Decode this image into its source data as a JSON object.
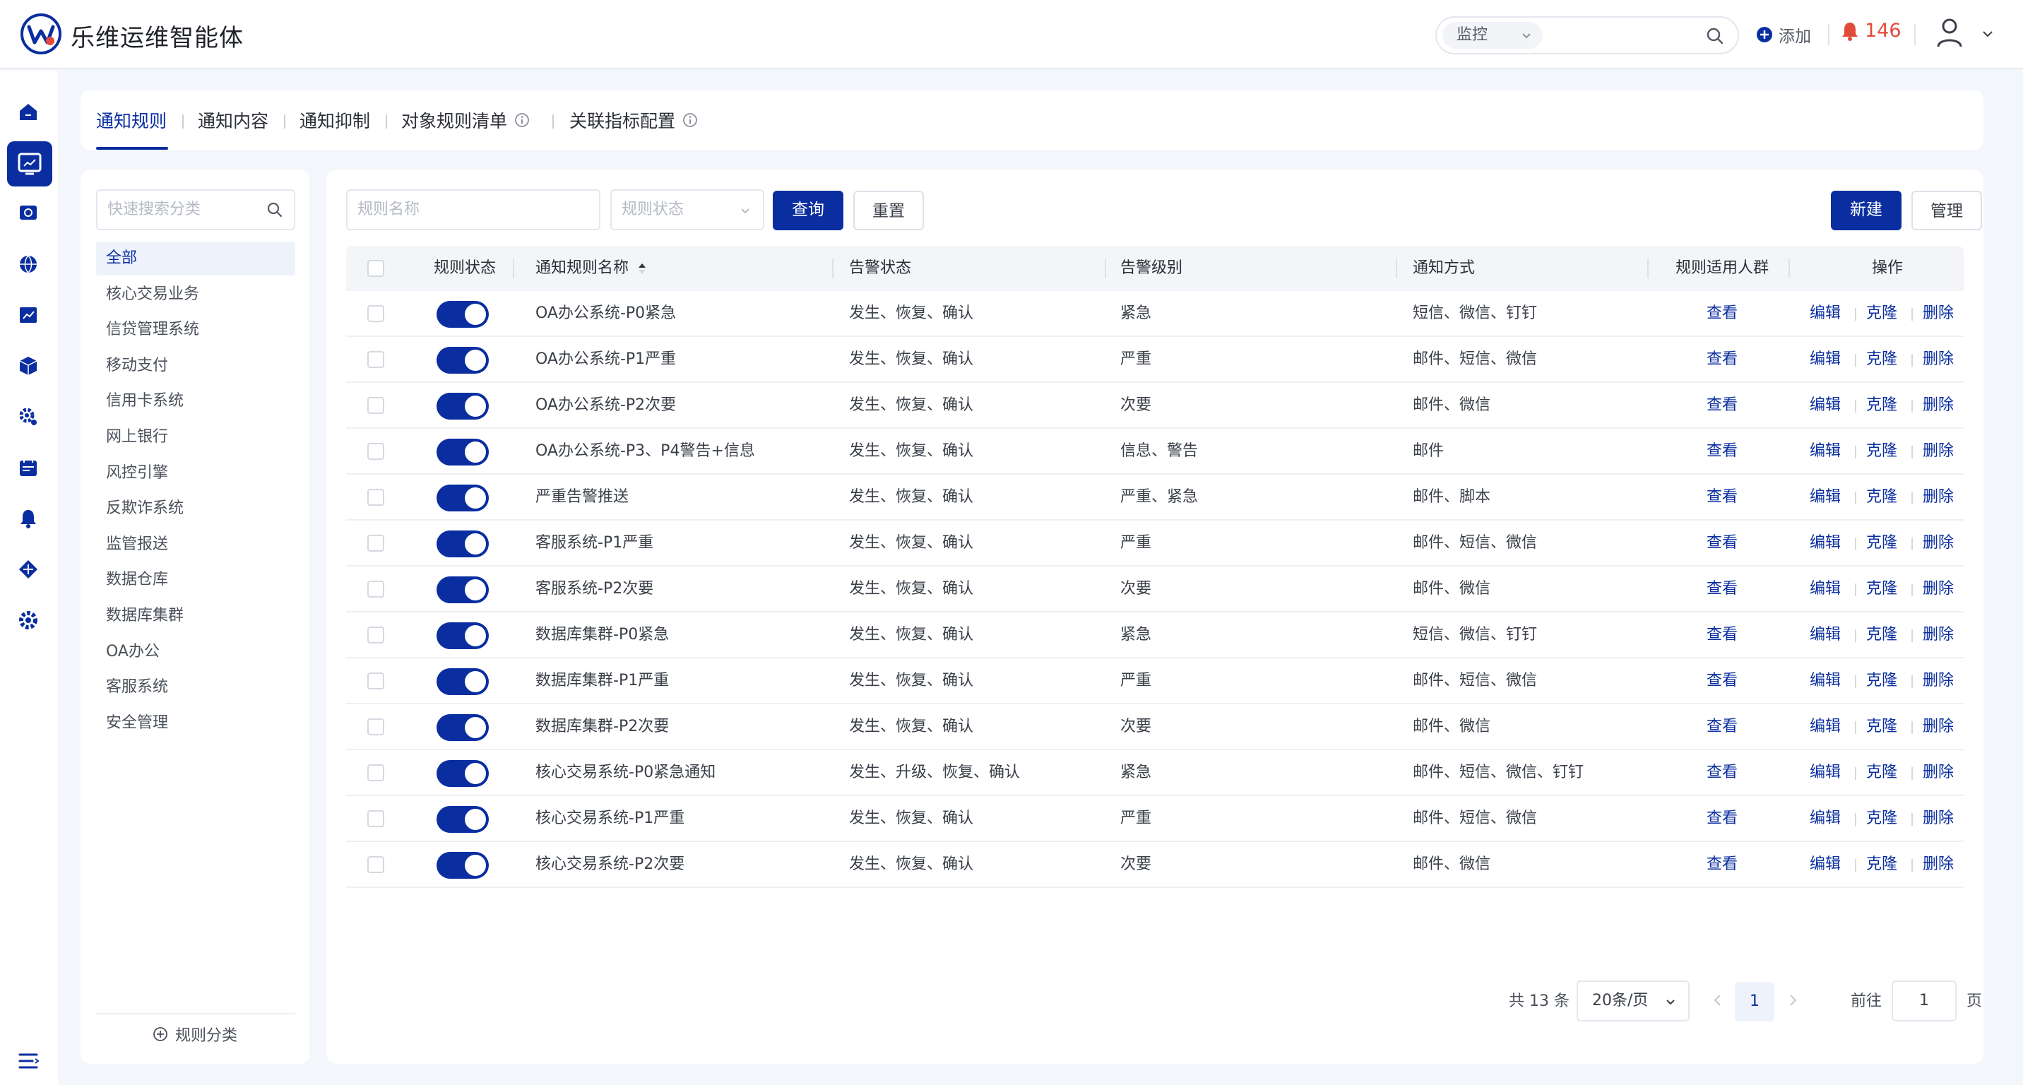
{
  "app": {
    "title": "乐维运维智能体"
  },
  "header": {
    "search_scope": "监控",
    "search_placeholder": "",
    "add_label": "添加",
    "alarm_count": "146"
  },
  "tabs": [
    {
      "label": "通知规则",
      "active": true
    },
    {
      "label": "通知内容"
    },
    {
      "label": "通知抑制"
    },
    {
      "label": "对象规则清单",
      "info": true
    },
    {
      "label": "关联指标配置",
      "info": true
    }
  ],
  "categories": {
    "search_placeholder": "快速搜索分类",
    "items": [
      "全部",
      "核心交易业务",
      "信贷管理系统",
      "移动支付",
      "信用卡系统",
      "网上银行",
      "风控引擎",
      "反欺诈系统",
      "监管报送",
      "数据仓库",
      "数据库集群",
      "OA办公",
      "客服系统",
      "安全管理"
    ],
    "active_index": 0,
    "add_label": "规则分类"
  },
  "filters": {
    "name_placeholder": "规则名称",
    "status_placeholder": "规则状态",
    "query_label": "查询",
    "reset_label": "重置",
    "new_label": "新建",
    "manage_label": "管理"
  },
  "table": {
    "headers": {
      "status": "规则状态",
      "name": "通知规则名称",
      "alarm_state": "告警状态",
      "alarm_level": "告警级别",
      "method": "通知方式",
      "audience": "规则适用人群",
      "ops": "操作"
    },
    "view_label": "查看",
    "edit_label": "编辑",
    "clone_label": "克隆",
    "delete_label": "删除",
    "rows": [
      {
        "name": "OA办公系统-P0紧急",
        "state": "发生、恢复、确认",
        "level": "紧急",
        "method": "短信、微信、钉钉"
      },
      {
        "name": "OA办公系统-P1严重",
        "state": "发生、恢复、确认",
        "level": "严重",
        "method": "邮件、短信、微信"
      },
      {
        "name": "OA办公系统-P2次要",
        "state": "发生、恢复、确认",
        "level": "次要",
        "method": "邮件、微信"
      },
      {
        "name": "OA办公系统-P3、P4警告+信息",
        "state": "发生、恢复、确认",
        "level": "信息、警告",
        "method": "邮件"
      },
      {
        "name": "严重告警推送",
        "state": "发生、恢复、确认",
        "level": "严重、紧急",
        "method": "邮件、脚本"
      },
      {
        "name": "客服系统-P1严重",
        "state": "发生、恢复、确认",
        "level": "严重",
        "method": "邮件、短信、微信"
      },
      {
        "name": "客服系统-P2次要",
        "state": "发生、恢复、确认",
        "level": "次要",
        "method": "邮件、微信"
      },
      {
        "name": "数据库集群-P0紧急",
        "state": "发生、恢复、确认",
        "level": "紧急",
        "method": "短信、微信、钉钉"
      },
      {
        "name": "数据库集群-P1严重",
        "state": "发生、恢复、确认",
        "level": "严重",
        "method": "邮件、短信、微信"
      },
      {
        "name": "数据库集群-P2次要",
        "state": "发生、恢复、确认",
        "level": "次要",
        "method": "邮件、微信"
      },
      {
        "name": "核心交易系统-P0紧急通知",
        "state": "发生、升级、恢复、确认",
        "level": "紧急",
        "method": "邮件、短信、微信、钉钉"
      },
      {
        "name": "核心交易系统-P1严重",
        "state": "发生、恢复、确认",
        "level": "严重",
        "method": "邮件、短信、微信"
      },
      {
        "name": "核心交易系统-P2次要",
        "state": "发生、恢复、确认",
        "level": "次要",
        "method": "邮件、微信"
      }
    ]
  },
  "pagination": {
    "total_text": "共 13 条",
    "page_size": "20条/页",
    "current_page": "1",
    "goto_label": "前往",
    "goto_value": "1",
    "page_unit": "页"
  },
  "colors": {
    "primary": "#0a2ea0",
    "alarm": "#e24a3a"
  }
}
